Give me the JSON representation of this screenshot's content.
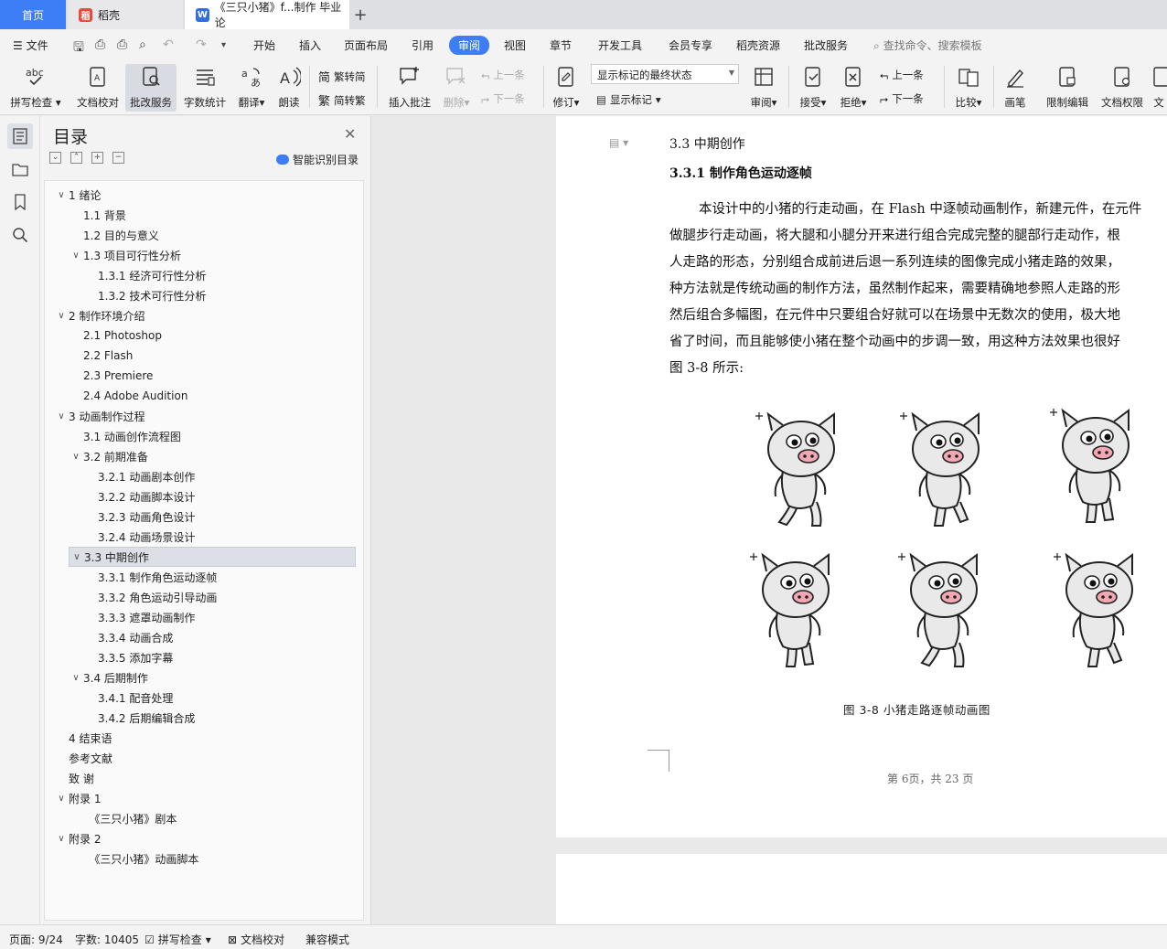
{
  "tabs": {
    "home": "首页",
    "daoke": "稻壳",
    "doc": "《三只小猪》f...制作 毕业论",
    "add": "+"
  },
  "menu": {
    "file": "文件",
    "items": [
      "开始",
      "插入",
      "页面布局",
      "引用",
      "审阅",
      "视图",
      "章节",
      "开发工具",
      "会员专享",
      "稻壳资源",
      "批改服务"
    ],
    "active": "审阅",
    "search": "查找命令、搜索模板"
  },
  "ribbon": {
    "spell": "拼写检查",
    "doccheck": "文档校对",
    "correct": "批改服务",
    "wordcount": "字数统计",
    "translate": "翻译",
    "read": "朗读",
    "trad": "繁转简",
    "simp": "简转繁",
    "insert_comment": "插入批注",
    "delete": "删除",
    "prev": "上一条",
    "next": "下一条",
    "revise": "修订",
    "markup_state": "显示标记的最终状态",
    "show_markup": "显示标记",
    "review": "审阅",
    "accept": "接受",
    "reject": "拒绝",
    "prev2": "上一条",
    "next2": "下一条",
    "compare": "比较",
    "pen": "画笔",
    "restrict": "限制编辑",
    "perm": "文档权限",
    "more": "文"
  },
  "toc": {
    "title": "目录",
    "smart": "智能识别目录",
    "items": [
      {
        "text": "1  绪论",
        "level": 0,
        "chev": true
      },
      {
        "text": "1.1  背景",
        "level": 1
      },
      {
        "text": "1.2  目的与意义",
        "level": 1
      },
      {
        "text": "1.3  项目可行性分析",
        "level": 1,
        "chev": true
      },
      {
        "text": "1.3.1  经济可行性分析",
        "level": 2
      },
      {
        "text": "1.3.2  技术可行性分析",
        "level": 2
      },
      {
        "text": "2  制作环境介绍",
        "level": 0,
        "chev": true
      },
      {
        "text": "2.1 Photoshop",
        "level": 1
      },
      {
        "text": "2.2 Flash",
        "level": 1
      },
      {
        "text": "2.3 Premiere",
        "level": 1
      },
      {
        "text": "2.4 Adobe Audition",
        "level": 1
      },
      {
        "text": "3  动画制作过程",
        "level": 0,
        "chev": true
      },
      {
        "text": "3.1  动画创作流程图",
        "level": 1
      },
      {
        "text": "3.2  前期准备",
        "level": 1,
        "chev": true
      },
      {
        "text": "3.2.1 动画剧本创作",
        "level": 2
      },
      {
        "text": "3.2.2 动画脚本设计",
        "level": 2
      },
      {
        "text": "3.2.3 动画角色设计",
        "level": 2
      },
      {
        "text": "3.2.4 动画场景设计",
        "level": 2
      },
      {
        "text": "3.3  中期创作",
        "level": 1,
        "chev": true,
        "selected": true
      },
      {
        "text": "3.3.1  制作角色运动逐帧",
        "level": 2
      },
      {
        "text": "3.3.2  角色运动引导动画",
        "level": 2
      },
      {
        "text": "3.3.3  遮罩动画制作",
        "level": 2
      },
      {
        "text": "3.3.4  动画合成",
        "level": 2
      },
      {
        "text": "3.3.5  添加字幕",
        "level": 2
      },
      {
        "text": "3.4  后期制作",
        "level": 1,
        "chev": true
      },
      {
        "text": "3.4.1  配音处理",
        "level": 2
      },
      {
        "text": "3.4.2  后期编辑合成",
        "level": 2
      },
      {
        "text": "4 结束语",
        "level": 0
      },
      {
        "text": "参考文献",
        "level": 0
      },
      {
        "text": "致       谢",
        "level": 0
      },
      {
        "text": "附录 1",
        "level": 0,
        "chev": true
      },
      {
        "text": "《三只小猪》剧本",
        "level": 1.4
      },
      {
        "text": "附录 2",
        "level": 0,
        "chev": true
      },
      {
        "text": "《三只小猪》动画脚本",
        "level": 1.4
      }
    ]
  },
  "doc": {
    "section": "3.3  中期创作",
    "subsection": "3.3.1  制作角色运动逐帧",
    "lines": [
      "本设计中的小猪的行走动画，在 Flash 中逐帧动画制作，新建元件，在元件",
      "做腿步行走动画，将大腿和小腿分开来进行组合完成完整的腿部行走动作，根",
      "人走路的形态，分别组合成前进后退一系列连续的图像完成小猪走路的效果，",
      "种方法就是传统动画的制作方法，虽然制作起来，需要精确地参照人走路的形",
      "然后组合多幅图，在元件中只要组合好就可以在场景中无数次的使用，极大地",
      "省了时间，而且能够使小猪在整个动画中的步调一致，用这种方法效果也很好",
      "图 3-8 所示:"
    ],
    "caption": "图 3-8  小猪走路逐帧动画图",
    "footer": "第 6页，共 23 页"
  },
  "status": {
    "page": "页面: 9/24",
    "words": "字数: 10405",
    "spell": "拼写检查",
    "doccheck": "文档校对",
    "compat": "兼容模式"
  },
  "colors": {
    "accent": "#3d7ef6",
    "wps_red": "#e84a3a",
    "wps_blue": "#2f6fe0",
    "pig_nose": "#f2a7b3"
  }
}
